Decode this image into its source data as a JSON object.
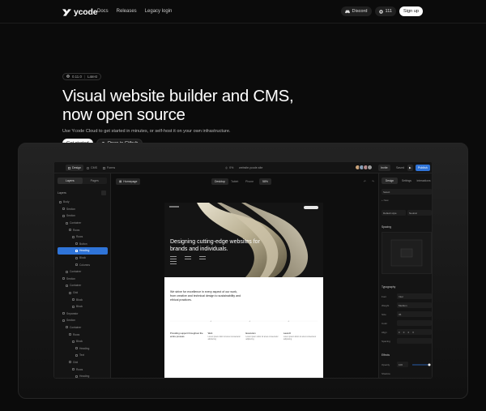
{
  "nav": {
    "brand": "ycode",
    "links": [
      "Docs",
      "Releases",
      "Legacy login"
    ],
    "discord": "Discord",
    "github_count": "111",
    "signup": "Sign up"
  },
  "hero": {
    "badge_version": "0.11.0",
    "badge_tag": "Latest",
    "title_line1": "Visual website builder and CMS,",
    "title_line2": "now open source",
    "subtitle": "Use Ycode Cloud to get started in minutes, or self-host it on your own infrastructure.",
    "cta_primary": "Get started",
    "cta_secondary": "Open in Github"
  },
  "app": {
    "top_tabs": [
      "Design",
      "CMS",
      "Forms"
    ],
    "zoom": "0%",
    "url": "website.ycode.site",
    "invite": "Invite",
    "saved": "Saved",
    "publish": "Publish",
    "left_tabs": [
      "Layers",
      "Pages"
    ],
    "page_name": "Homepage",
    "breakpoints": [
      "Desktop",
      "Tablet",
      "Phone"
    ],
    "canvas_zoom": "58%",
    "layers_title": "Layers",
    "layers": [
      {
        "label": "Body",
        "indent": 0
      },
      {
        "label": "Section",
        "indent": 1
      },
      {
        "label": "Section",
        "indent": 1
      },
      {
        "label": "Container",
        "indent": 2
      },
      {
        "label": "Rows",
        "indent": 3
      },
      {
        "label": "Rows",
        "indent": 4
      },
      {
        "label": "Button",
        "indent": 5
      },
      {
        "label": "Heading",
        "indent": 5,
        "selected": true
      },
      {
        "label": "Block",
        "indent": 5
      },
      {
        "label": "Columns",
        "indent": 5
      },
      {
        "label": "Container",
        "indent": 2
      },
      {
        "label": "Section",
        "indent": 1
      },
      {
        "label": "Container",
        "indent": 2
      },
      {
        "label": "Grid",
        "indent": 3
      },
      {
        "label": "Block",
        "indent": 4
      },
      {
        "label": "Block",
        "indent": 4
      },
      {
        "label": "Separator",
        "indent": 1
      },
      {
        "label": "Section",
        "indent": 1
      },
      {
        "label": "Container",
        "indent": 2
      },
      {
        "label": "Rows",
        "indent": 3
      },
      {
        "label": "Block",
        "indent": 4
      },
      {
        "label": "Heading",
        "indent": 5
      },
      {
        "label": "Text",
        "indent": 5
      },
      {
        "label": "Grid",
        "indent": 3
      },
      {
        "label": "Rows",
        "indent": 4
      },
      {
        "label": "Heading",
        "indent": 5
      }
    ],
    "right_tabs": [
      "Design",
      "Settings",
      "Interactions"
    ],
    "right": {
      "select": "Select",
      "new": "+ New",
      "default_style": "Default style",
      "neutral": "Neutral",
      "spacing": "Spacing",
      "typography": "Typography",
      "font_label": "Font",
      "font_value": "Inter",
      "weight_label": "Weight",
      "weight_value": "Medium",
      "size_label": "Size",
      "size_value": "36",
      "color_label": "Color",
      "align_label": "Align",
      "spacing_label": "Spacing",
      "effects": "Effects",
      "opacity_label": "Opacity",
      "opacity_value": "100",
      "shadow_label": "Shadow"
    },
    "preview": {
      "title": "Designing cutting-edge websites for brands and individuals.",
      "body": "We strive for excellence in every aspect of our work, from creative and technical design to sustainability and ethical practices.",
      "columns": [
        {
          "heading": "Providing support throughout the entire process",
          "text": ""
        },
        {
          "heading": "Web",
          "text": "Lorem ipsum dolor sit amet consectetur adipiscing"
        },
        {
          "heading": "Execution",
          "text": "Lorem ipsum dolor sit amet consectetur adipiscing"
        },
        {
          "heading": "Launch",
          "text": "Lorem ipsum dolor sit amet consectetur adipiscing"
        }
      ]
    }
  },
  "colors": {
    "accent": "#2f74d8",
    "background": "#0b0b0b"
  }
}
